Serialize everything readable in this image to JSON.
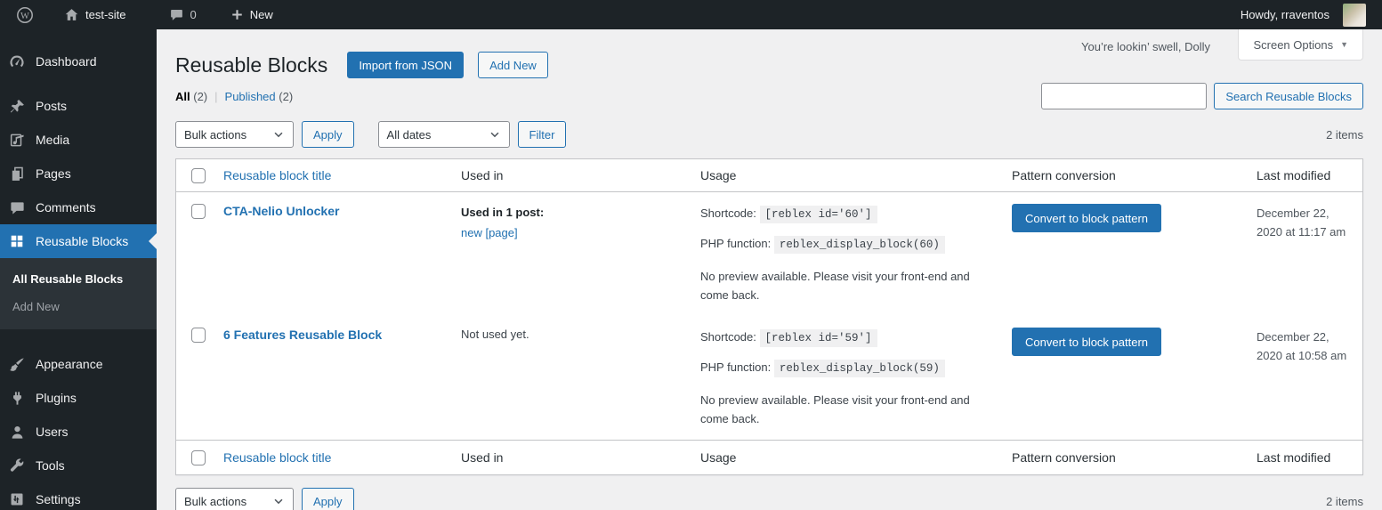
{
  "colors": {
    "accent": "#2271b1",
    "admin_bar_bg": "#1d2327",
    "submenu_bg": "#2c3338",
    "content_bg": "#f0f0f1",
    "table_border": "#c3c4c7",
    "code_bg": "#f0f0f1",
    "muted_text": "#50575e"
  },
  "admin_bar": {
    "site_name": "test-site",
    "comment_count": "0",
    "new_label": "New",
    "howdy": "Howdy, rraventos"
  },
  "sidebar": {
    "items": [
      {
        "label": "Dashboard"
      },
      {
        "label": "Posts"
      },
      {
        "label": "Media"
      },
      {
        "label": "Pages"
      },
      {
        "label": "Comments"
      },
      {
        "label": "Reusable Blocks"
      },
      {
        "label": "Appearance"
      },
      {
        "label": "Plugins"
      },
      {
        "label": "Users"
      },
      {
        "label": "Tools"
      },
      {
        "label": "Settings"
      }
    ],
    "submenu": {
      "all": "All Reusable Blocks",
      "add_new": "Add New"
    }
  },
  "header": {
    "greeting": "You’re lookin’ swell, Dolly",
    "screen_options": "Screen Options",
    "title": "Reusable Blocks",
    "import_button": "Import from JSON",
    "add_new_button": "Add New"
  },
  "filters": {
    "views": {
      "all": "All",
      "all_count": "(2)",
      "separator": "|",
      "published": "Published",
      "published_count": "(2)"
    },
    "bulk_actions": "Bulk actions",
    "apply": "Apply",
    "all_dates": "All dates",
    "filter": "Filter",
    "search_button": "Search Reusable Blocks",
    "items_count": "2 items"
  },
  "table": {
    "columns": {
      "title": "Reusable block title",
      "used_in": "Used in",
      "usage": "Usage",
      "pattern": "Pattern conversion",
      "modified": "Last modified"
    },
    "rows": [
      {
        "title": "CTA-Nelio Unlocker",
        "used_in_bold": "Used in 1 post:",
        "used_in_link": "new [page]",
        "shortcode_label": "Shortcode:",
        "shortcode": "[reblex id='60']",
        "php_label": "PHP function:",
        "php_function": "reblex_display_block(60)",
        "preview_note": "No preview available. Please visit your front-end and come back.",
        "convert_button": "Convert to block pattern",
        "last_modified": "December 22, 2020 at 11:17 am"
      },
      {
        "title": "6 Features Reusable Block",
        "used_in_text": "Not used yet.",
        "shortcode_label": "Shortcode:",
        "shortcode": "[reblex id='59']",
        "php_label": "PHP function:",
        "php_function": "reblex_display_block(59)",
        "preview_note": "No preview available. Please visit your front-end and come back.",
        "convert_button": "Convert to block pattern",
        "last_modified": "December 22, 2020 at 10:58 am"
      }
    ]
  },
  "footer_nav": {
    "bulk_actions": "Bulk actions",
    "apply": "Apply",
    "items_count": "2 items"
  }
}
